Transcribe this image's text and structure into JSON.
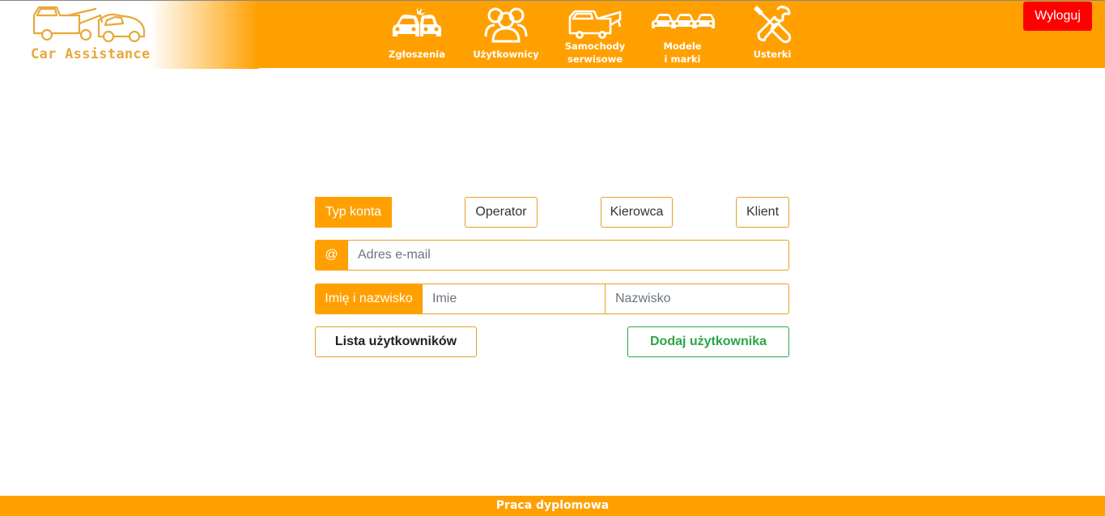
{
  "app": {
    "name": "Car Assistance",
    "logout_label": "Wyloguj",
    "accent": "#ffa000",
    "logout_color": "#ff0000"
  },
  "nav": {
    "items": [
      {
        "label": "Zgłoszenia",
        "icon": "car-crash-icon"
      },
      {
        "label": "Użytkownicy",
        "icon": "users-icon"
      },
      {
        "label_line1": "Samochody",
        "label_line2": "serwisowe",
        "icon": "tow-truck-icon"
      },
      {
        "label_line1": "Modele",
        "label_line2": "i marki",
        "icon": "cars-icon"
      },
      {
        "label": "Usterki",
        "icon": "wrench-screwdriver-icon"
      }
    ]
  },
  "form": {
    "account_type_label": "Typ konta",
    "account_types": [
      "Operator",
      "Kierowca",
      "Klient"
    ],
    "email_prefix": "@",
    "email_placeholder": "Adres e-mail",
    "name_label": "Imię i nazwisko",
    "first_name_placeholder": "Imie",
    "last_name_placeholder": "Nazwisko",
    "user_list_button": "Lista użytkowników",
    "add_user_button": "Dodaj użytkownika",
    "add_color": "#28a745"
  },
  "footer": {
    "text": "Praca dyplomowa"
  }
}
